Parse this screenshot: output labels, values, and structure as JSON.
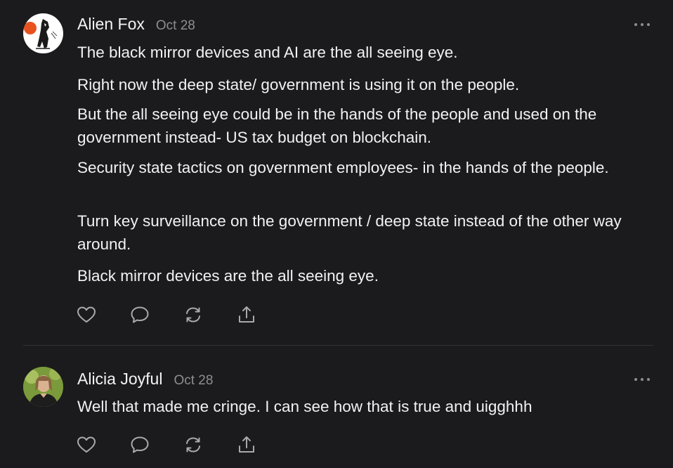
{
  "comments": [
    {
      "author": "Alien Fox",
      "date": "Oct 28",
      "paragraphs": [
        "The black mirror devices and AI are the all seeing eye.",
        "Right now the deep state/ government is using it on the people.",
        "But the all seeing eye could be in the hands of the people and used on the government instead- US tax budget on blockchain.",
        "Security state tactics on government employees- in the hands of the people.",
        "Turn key surveillance on the government / deep state instead of the other way around.",
        "Black mirror devices are the all seeing eye."
      ]
    },
    {
      "author": "Alicia Joyful",
      "date": "Oct 28",
      "paragraphs": [
        "Well that made me cringe. I can see how that is true and uigghhh"
      ]
    }
  ],
  "icons": {
    "like": "heart-icon",
    "reply": "speech-bubble-icon",
    "restack": "repost-icon",
    "share": "share-icon",
    "more": "more-dots-icon"
  },
  "colors": {
    "background": "#1b1b1d",
    "text": "#f2f2f3",
    "muted": "#8e8e93",
    "divider": "#333336"
  }
}
